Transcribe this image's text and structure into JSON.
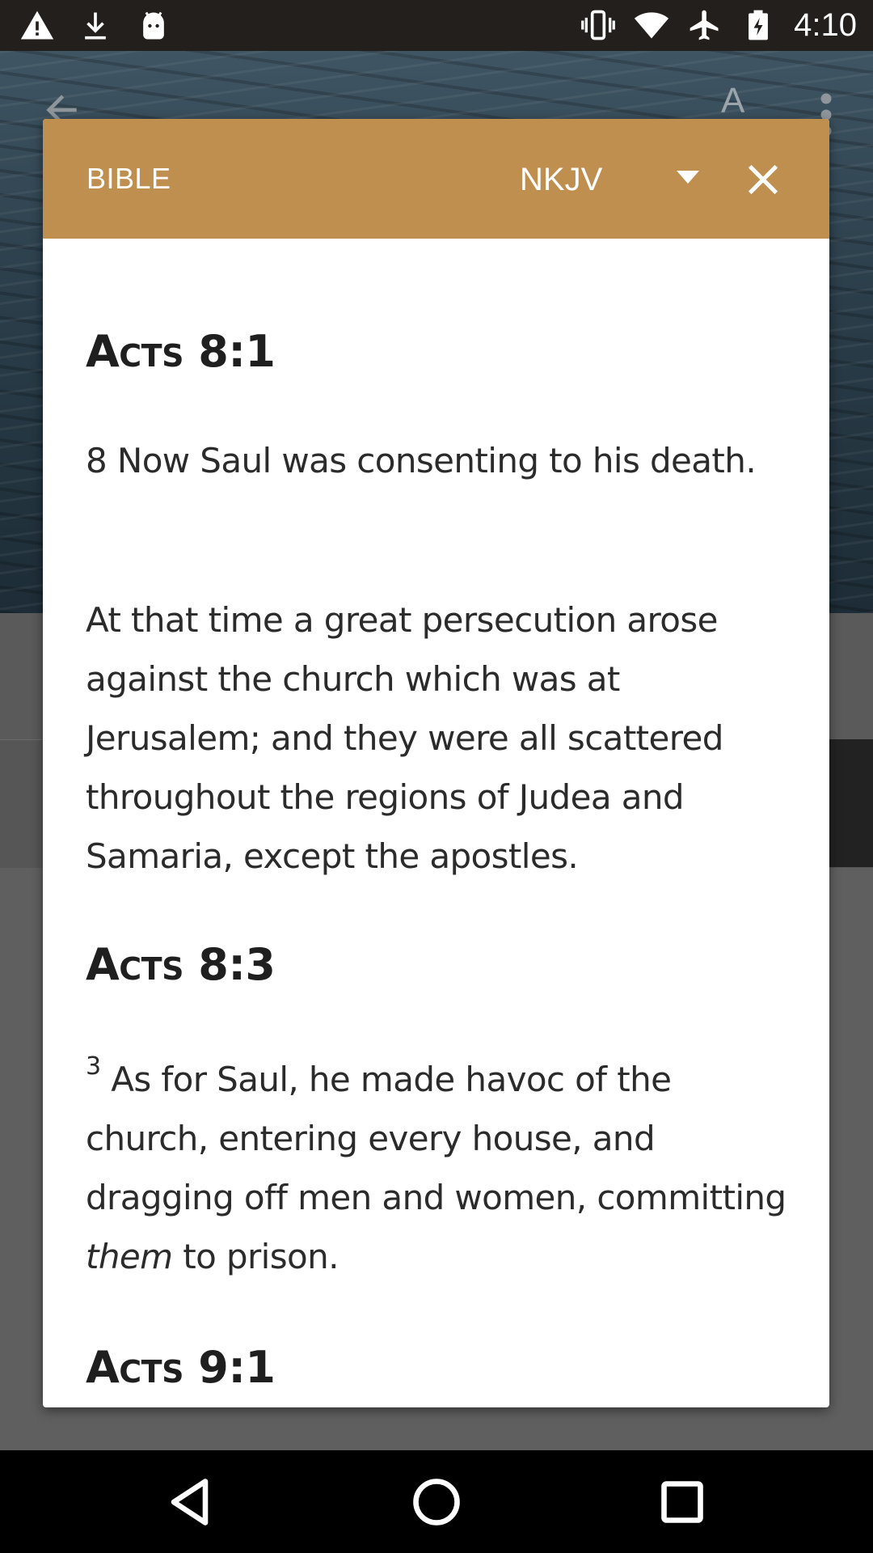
{
  "status_bar": {
    "time": "4:10",
    "left_icons": [
      "warning-icon",
      "download-icon",
      "android-icon"
    ],
    "right_icons": [
      "vibrate-icon",
      "wifi-icon",
      "airplane-icon",
      "battery-icon"
    ]
  },
  "background_app": {
    "font_button_label": "A",
    "icons": [
      "back-arrow-icon",
      "more-vert-icon"
    ]
  },
  "dialog": {
    "title": "BIBLE",
    "version": "NKJV",
    "close_icon": "close-icon",
    "dropdown_icon": "triangle-down-icon",
    "passages": [
      {
        "reference": "Acts 8:1",
        "paragraphs": [
          "8 Now Saul was consenting to his death.",
          "At that time a great persecution arose against the church which was at Jerusalem; and they were all scattered throughout the regions of Judea and Samaria, except the apostles."
        ]
      },
      {
        "reference": "Acts 8:3",
        "verse_number": "3",
        "text_before_italic": "As for Saul, he made havoc of the church, entering every house, and dragging off men and women, committing ",
        "italic_text": "them",
        "text_after_italic": " to prison."
      },
      {
        "reference": "Acts 9:1"
      }
    ]
  },
  "nav_bar": {
    "icons": [
      "back-triangle-icon",
      "home-circle-icon",
      "recents-square-icon"
    ]
  },
  "colors": {
    "dialog_header": "#bf8f50",
    "status_bar": "#231f1d",
    "nav_bar": "#000000",
    "scrim": "#5f5f5f"
  }
}
